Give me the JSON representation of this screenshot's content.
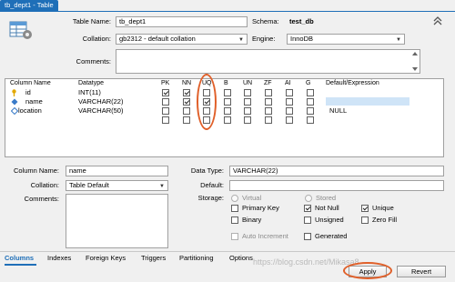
{
  "window": {
    "tab_title": "tb_dept1 - Table"
  },
  "table_props": {
    "table_name_label": "Table Name:",
    "table_name_value": "tb_dept1",
    "schema_label": "Schema:",
    "schema_value": "test_db",
    "collation_label": "Collation:",
    "collation_value": "gb2312 - default collation",
    "engine_label": "Engine:",
    "engine_value": "InnoDB",
    "comments_label": "Comments:",
    "comments_value": ""
  },
  "grid": {
    "headers": {
      "name": "Column Name",
      "datatype": "Datatype",
      "pk": "PK",
      "nn": "NN",
      "uq": "UQ",
      "b": "B",
      "un": "UN",
      "zf": "ZF",
      "ai": "AI",
      "g": "G",
      "default": "Default/Expression"
    },
    "rows": [
      {
        "name": "id",
        "datatype": "INT(11)",
        "default": ""
      },
      {
        "name": "name",
        "datatype": "VARCHAR(22)",
        "default": ""
      },
      {
        "name": "location",
        "datatype": "VARCHAR(50)",
        "default": "NULL"
      }
    ]
  },
  "column_details": {
    "column_name_label": "Column Name:",
    "column_name_value": "name",
    "collation_label": "Collation:",
    "collation_value": "Table Default",
    "comments_label": "Comments:",
    "data_type_label": "Data Type:",
    "data_type_value": "VARCHAR(22)",
    "default_label": "Default:",
    "default_value": "",
    "storage_label": "Storage:",
    "storage_virtual": "Virtual",
    "storage_stored": "Stored",
    "primary_key": "Primary Key",
    "not_null": "Not Null",
    "unique": "Unique",
    "binary": "Binary",
    "unsigned": "Unsigned",
    "zero_fill": "Zero Fill",
    "auto_increment": "Auto Increment",
    "generated": "Generated"
  },
  "bottom_tabs": [
    "Columns",
    "Indexes",
    "Foreign Keys",
    "Triggers",
    "Partitioning",
    "Options"
  ],
  "buttons": {
    "apply": "Apply",
    "revert": "Revert"
  },
  "watermark": "https://blog.csdn.net/Mikasa8",
  "colors": {
    "accent": "#1f6fb8",
    "highlight": "#e0602a"
  }
}
